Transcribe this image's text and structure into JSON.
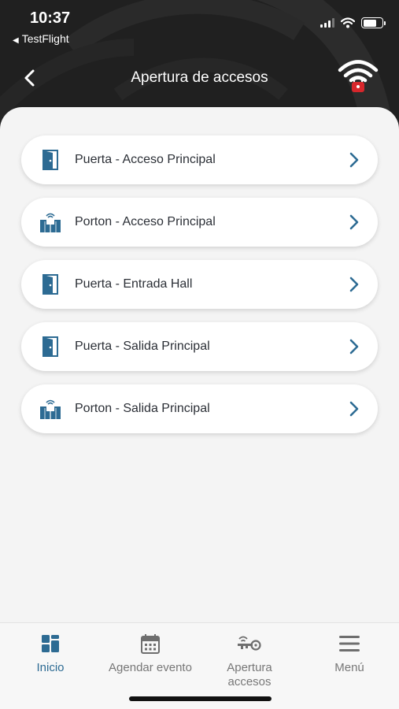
{
  "status_bar": {
    "time": "10:37",
    "back_app": "TestFlight"
  },
  "header": {
    "title": "Apertura de accesos",
    "back_icon": "chevron-left-icon",
    "status_icon": "wifi-lock-icon"
  },
  "colors": {
    "accent": "#2d6b93",
    "header_bg": "#202020",
    "lock_red": "#d7262b"
  },
  "access_items": [
    {
      "label": "Puerta - Acceso Principal",
      "icon": "door-icon"
    },
    {
      "label": "Porton - Acceso Principal",
      "icon": "gate-icon"
    },
    {
      "label": "Puerta - Entrada Hall",
      "icon": "door-icon"
    },
    {
      "label": "Puerta - Salida Principal",
      "icon": "door-icon"
    },
    {
      "label": "Porton - Salida Principal",
      "icon": "gate-icon"
    }
  ],
  "tabs": [
    {
      "label": "Inicio",
      "icon": "grid-icon",
      "active": true
    },
    {
      "label": "Agendar evento",
      "icon": "calendar-icon",
      "active": false
    },
    {
      "label_line1": "Apertura",
      "label_line2": "accesos",
      "icon": "key-wifi-icon",
      "active": false
    },
    {
      "label": "Menú",
      "icon": "hamburger-icon",
      "active": false
    }
  ]
}
